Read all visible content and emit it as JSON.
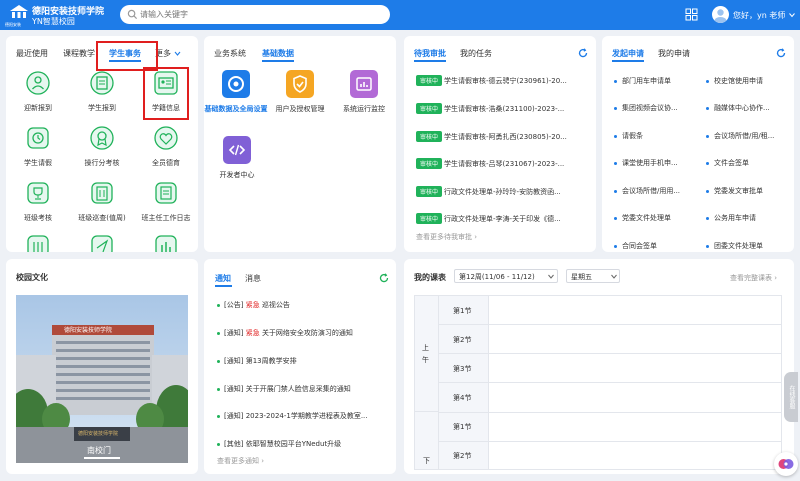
{
  "header": {
    "logo_text": "德阳安装",
    "school_name": "德阳安装技师学院",
    "school_sub": "YN智慧校园",
    "search_placeholder": "请输入关键字",
    "greeting": "您好，yn 老师"
  },
  "service_panel": {
    "tabs": [
      "最近使用",
      "课程教学",
      "学生事务",
      "更多"
    ],
    "active_tab": "学生事务",
    "tiles": [
      {
        "label": "迎新报到",
        "icon": "person-icon"
      },
      {
        "label": "学生报到",
        "icon": "doc-icon"
      },
      {
        "label": "学籍信息",
        "icon": "id-card-icon"
      },
      {
        "label": "学生请假",
        "icon": "clock-doc-icon"
      },
      {
        "label": "操行分考核",
        "icon": "badge-icon"
      },
      {
        "label": "全员德育",
        "icon": "heart-icon"
      },
      {
        "label": "班级考核",
        "icon": "trophy-icon"
      },
      {
        "label": "班级巡查(值周)",
        "icon": "building-icon"
      },
      {
        "label": "班主任工作日志",
        "icon": "notebook-icon"
      }
    ]
  },
  "system_panel": {
    "tabs": [
      "业务系统",
      "基础数据"
    ],
    "active_tab": "基础数据",
    "tiles": [
      {
        "label": "基础数据及全局设置",
        "icon": "settings-icon"
      },
      {
        "label": "用户及授权管理",
        "icon": "shield-icon"
      },
      {
        "label": "系统运行监控",
        "icon": "monitor-icon"
      },
      {
        "label": "开发者中心",
        "icon": "code-icon"
      }
    ]
  },
  "approval_panel": {
    "tabs": [
      "待我审批",
      "我的任务"
    ],
    "active_tab": "待我审批",
    "badge_label": "审核中",
    "items": [
      "学生请假审核-德云骋宁(230961)-20...",
      "学生请假审核-浩桑(231100)-2023-...",
      "学生请假审核-阿勇扎西(230805)-20...",
      "学生请假审核-吕琴(231067)-2023-...",
      "行政文件处理单-孙玲玲-安防教资函...",
      "行政文件处理单-李涛-关于印发《德..."
    ],
    "more": "查看更多待我审批 ›"
  },
  "apply_panel": {
    "tabs": [
      "发起申请",
      "我的申请"
    ],
    "active_tab": "发起申请",
    "left": [
      "部门用车申请单",
      "集团视频会议协...",
      "请假条",
      "课堂使用手机申...",
      "会议场所借/用用...",
      "党委文件处理单",
      "合同会签单"
    ],
    "right": [
      "校史馆使用申请",
      "融媒体中心协作...",
      "会议场所借/用/租...",
      "文件会签单",
      "党委发文审批单",
      "公务用车申请",
      "团委文件处理单"
    ]
  },
  "culture_panel": {
    "title": "校园文化",
    "building_sign": "德阳安装技师学院",
    "stone_text": "德阳安装技师学院",
    "caption": "南校门"
  },
  "notice_panel": {
    "tabs": [
      "通知",
      "消息"
    ],
    "active_tab": "通知",
    "items": [
      {
        "tag": "[公告]",
        "urgent": "紧急",
        "text": "巡视公告"
      },
      {
        "tag": "[通知]",
        "urgent": "紧急",
        "text": "关于网络安全攻防演习的通知"
      },
      {
        "tag": "[通知]",
        "urgent": "",
        "text": "第13周教学安排"
      },
      {
        "tag": "[通知]",
        "urgent": "",
        "text": "关于开展门禁人脸信息采集的通知"
      },
      {
        "tag": "[通知]",
        "urgent": "",
        "text": "2023-2024-1学期教学进程表及教室..."
      },
      {
        "tag": "[其他]",
        "urgent": "",
        "text": "依耶智慧校园平台YNedut升级"
      }
    ],
    "more": "查看更多通知 ›"
  },
  "schedule_panel": {
    "title": "我的课表",
    "week": "第12周(11/06 - 11/12)",
    "day": "星期五",
    "view_all": "查看完整课表 ›",
    "morning_label": "上午",
    "afternoon_label": "下",
    "periods_morning": [
      "第1节",
      "第2节",
      "第3节",
      "第4节"
    ],
    "periods_afternoon": [
      "第1节",
      "第2节"
    ]
  },
  "side_float": "在线客服"
}
